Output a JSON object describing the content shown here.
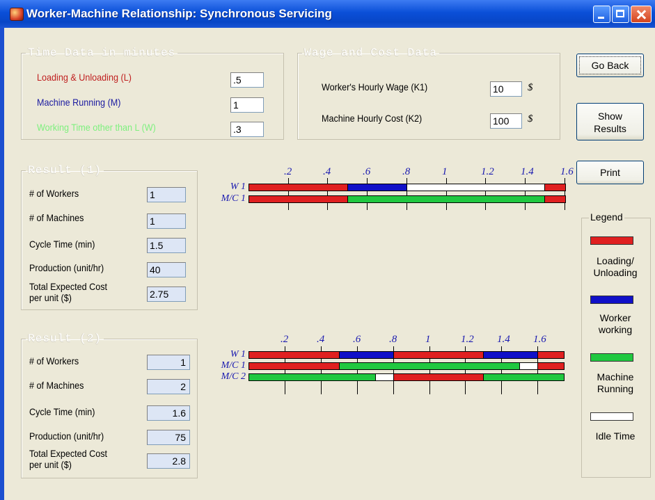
{
  "window": {
    "title": "Worker-Machine Relationship: Synchronous Servicing"
  },
  "time_data": {
    "legend": "Time Data in minutes",
    "loading_label": "Loading & Unloading (L)",
    "loading_value": ".5",
    "machine_label": "Machine Running (M)",
    "machine_value": "1",
    "other_label": "Working Time other than L (W)",
    "other_value": ".3",
    "colors": {
      "loading": "#c02020",
      "machine": "#1a1aa0",
      "other": "#7ef07e"
    }
  },
  "wage_data": {
    "legend": "Wage and Cost Data",
    "wage_label": "Worker's Hourly Wage (K1)",
    "wage_value": "10",
    "cost_label": "Machine Hourly Cost (K2)",
    "cost_value": "100",
    "currency": "$"
  },
  "buttons": {
    "go_back": "Go Back",
    "show_results_1": "Show",
    "show_results_2": "Results",
    "print": "Print"
  },
  "result1": {
    "legend": "Result (1)",
    "workers_label": "# of Workers",
    "workers": "1",
    "machines_label": "# of Machines",
    "machines": "1",
    "cycle_label": "Cycle Time (min)",
    "cycle": "1.5",
    "production_label": "Production (unit/hr)",
    "production": "40",
    "cost_label_1": "Total Expected Cost",
    "cost_label_2": "per unit ($)",
    "cost": "2.75"
  },
  "result2": {
    "legend": "Result (2)",
    "workers_label": "# of Workers",
    "workers": "1",
    "machines_label": "# of Machines",
    "machines": "2",
    "cycle_label": "Cycle Time (min)",
    "cycle": "1.6",
    "production_label": "Production (unit/hr)",
    "production": "75",
    "cost_label_1": "Total Expected Cost",
    "cost_label_2": "per unit ($)",
    "cost": "2.8"
  },
  "legend": {
    "title": "Legend",
    "items": [
      {
        "label_1": "Loading/",
        "label_2": "Unloading",
        "color": "#e02020"
      },
      {
        "label_1": "Worker",
        "label_2": "working",
        "color": "#1010c8"
      },
      {
        "label_1": "Machine",
        "label_2": "Running",
        "color": "#20c840"
      },
      {
        "label_1": "Idle Time",
        "label_2": "",
        "color": "#ffffff"
      }
    ]
  },
  "chart_data": [
    {
      "type": "gantt",
      "ticks": [
        ".2",
        ".4",
        ".6",
        ".8",
        "1",
        "1.2",
        "1.4",
        "1.6"
      ],
      "tick_values": [
        0.2,
        0.4,
        0.6,
        0.8,
        1.0,
        1.2,
        1.4,
        1.6
      ],
      "range": [
        0,
        1.6
      ],
      "rows": [
        {
          "name": "W 1",
          "segments": [
            {
              "start": 0,
              "end": 0.5,
              "kind": "loading"
            },
            {
              "start": 0.5,
              "end": 0.8,
              "kind": "working"
            },
            {
              "start": 0.8,
              "end": 1.5,
              "kind": "idle"
            },
            {
              "start": 1.5,
              "end": 1.6,
              "kind": "loading"
            }
          ]
        },
        {
          "name": "M/C 1",
          "segments": [
            {
              "start": 0,
              "end": 0.5,
              "kind": "loading"
            },
            {
              "start": 0.5,
              "end": 1.5,
              "kind": "running"
            },
            {
              "start": 1.5,
              "end": 1.6,
              "kind": "loading"
            }
          ]
        }
      ]
    },
    {
      "type": "gantt",
      "ticks": [
        ".2",
        ".4",
        ".6",
        ".8",
        "1",
        "1.2",
        "1.4",
        "1.6"
      ],
      "tick_values": [
        0.2,
        0.4,
        0.6,
        0.8,
        1.0,
        1.2,
        1.4,
        1.6
      ],
      "range": [
        0,
        1.75
      ],
      "rows": [
        {
          "name": "W 1",
          "segments": [
            {
              "start": 0,
              "end": 0.5,
              "kind": "loading"
            },
            {
              "start": 0.5,
              "end": 0.8,
              "kind": "working"
            },
            {
              "start": 0.8,
              "end": 1.3,
              "kind": "loading"
            },
            {
              "start": 1.3,
              "end": 1.6,
              "kind": "working"
            },
            {
              "start": 1.6,
              "end": 1.75,
              "kind": "loading"
            }
          ]
        },
        {
          "name": "M/C 1",
          "segments": [
            {
              "start": 0,
              "end": 0.5,
              "kind": "loading"
            },
            {
              "start": 0.5,
              "end": 1.5,
              "kind": "running"
            },
            {
              "start": 1.5,
              "end": 1.6,
              "kind": "idle"
            },
            {
              "start": 1.6,
              "end": 1.75,
              "kind": "loading"
            }
          ]
        },
        {
          "name": "M/C 2",
          "segments": [
            {
              "start": 0,
              "end": 0.7,
              "kind": "running"
            },
            {
              "start": 0.7,
              "end": 0.8,
              "kind": "idle"
            },
            {
              "start": 0.8,
              "end": 1.3,
              "kind": "loading"
            },
            {
              "start": 1.3,
              "end": 1.75,
              "kind": "running"
            }
          ]
        }
      ]
    }
  ]
}
